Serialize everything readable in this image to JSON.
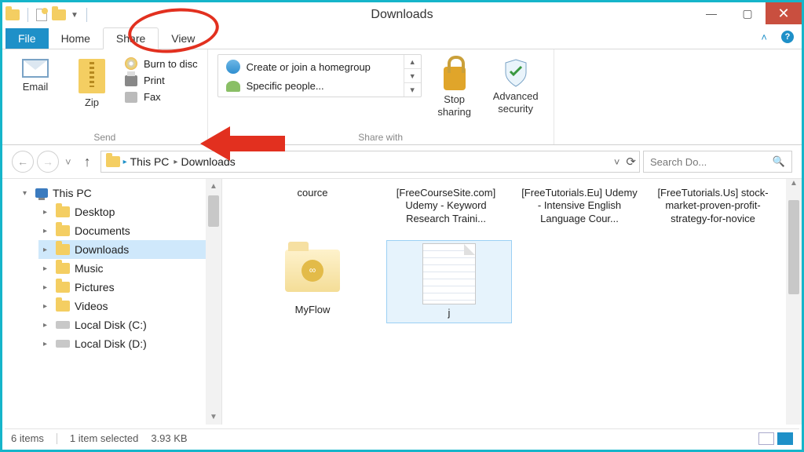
{
  "window": {
    "title": "Downloads"
  },
  "tabs": {
    "file": "File",
    "home": "Home",
    "share": "Share",
    "view": "View",
    "active": "Share"
  },
  "ribbon": {
    "send": {
      "label": "Send",
      "email": "Email",
      "zip": "Zip",
      "burn": "Burn to disc",
      "print": "Print",
      "fax": "Fax"
    },
    "sharewith": {
      "label": "Share with",
      "homegroup": "Create or join a homegroup",
      "specific": "Specific people...",
      "stop": "Stop sharing",
      "advanced": "Advanced security"
    }
  },
  "breadcrumb": {
    "root": "This PC",
    "current": "Downloads"
  },
  "search": {
    "placeholder": "Search Do..."
  },
  "tree": {
    "root": "This PC",
    "items": [
      {
        "label": "Desktop"
      },
      {
        "label": "Documents"
      },
      {
        "label": "Downloads",
        "selected": true
      },
      {
        "label": "Music"
      },
      {
        "label": "Pictures"
      },
      {
        "label": "Videos"
      },
      {
        "label": "Local Disk (C:)"
      },
      {
        "label": "Local Disk (D:)"
      }
    ]
  },
  "files": {
    "toprow": [
      {
        "name": "cource"
      },
      {
        "name": "[FreeCourseSite.com] Udemy - Keyword Research Traini..."
      },
      {
        "name": "[FreeTutorials.Eu] Udemy - Intensive English Language Cour..."
      },
      {
        "name": "[FreeTutorials.Us] stock-market-proven-profit-strategy-for-novice"
      }
    ],
    "row2": [
      {
        "name": "MyFlow",
        "type": "folder"
      },
      {
        "name": "j",
        "type": "file",
        "selected": true
      }
    ]
  },
  "status": {
    "count": "6 items",
    "selection": "1 item selected",
    "size": "3.93 KB"
  }
}
